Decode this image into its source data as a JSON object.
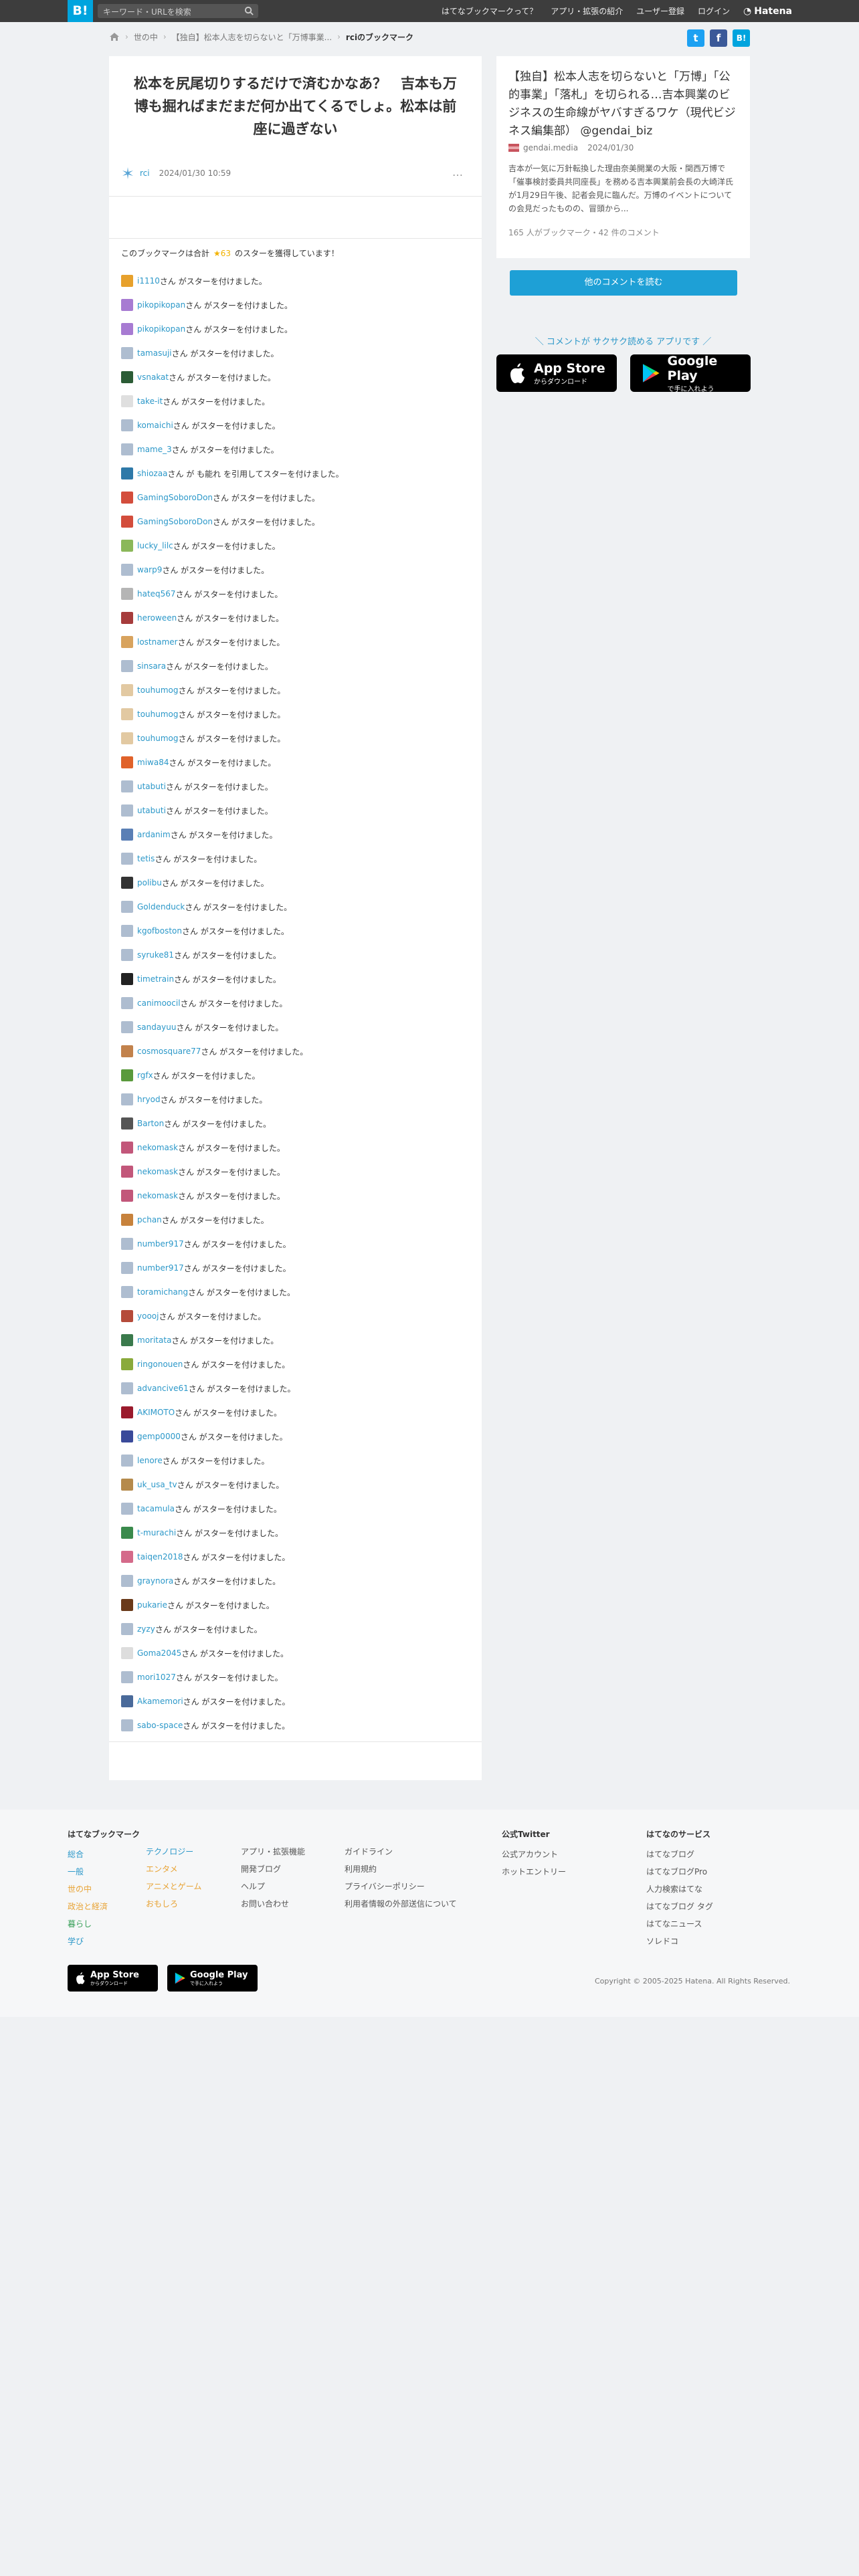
{
  "topbar": {
    "logo": "B!",
    "search_placeholder": "キーワード・URLを検索",
    "nav": [
      "はてなブックマークって？",
      "アプリ・拡張の紹介",
      "ユーザー登録",
      "ログイン"
    ],
    "hatena_label": "Hatena"
  },
  "breadcrumb": {
    "items": [
      "世の中",
      "【独自】松本人志を切らないと「万博事業..."
    ],
    "current": "rciのブックマーク"
  },
  "share": {
    "twitter": "t",
    "facebook": "f",
    "hatebu": "B!"
  },
  "entry": {
    "title": "松本を尻尾切りするだけで済むかなあ？　吉本も万博も掘ればまだまだ何か出てくるでしょ。松本は前座に過ぎない",
    "user": "rci",
    "date": "2024/01/30 10:59",
    "more": "…"
  },
  "summary": {
    "prefix": "このブックマークは合計",
    "star": "★63",
    "suffix": "のスターを獲得しています！"
  },
  "stars": [
    {
      "user": "i1110",
      "text": "さん がスターを付けました。",
      "color": "#e7a12c"
    },
    {
      "user": "pikopikopan",
      "text": "さん がスターを付けました。",
      "color": "#a77bd2"
    },
    {
      "user": "pikopikopan",
      "text": "さん がスターを付けました。",
      "color": "#a77bd2"
    },
    {
      "user": "tamasuji",
      "text": "さん がスターを付けました。",
      "color": "#aebdd0"
    },
    {
      "user": "vsnakat",
      "text": "さん がスターを付けました。",
      "color": "#2b5c35"
    },
    {
      "user": "take-it",
      "text": "さん がスターを付けました。",
      "color": "#dfdfdf"
    },
    {
      "user": "komaichi",
      "text": "さん がスターを付けました。",
      "color": "#aebdd0"
    },
    {
      "user": "mame_3",
      "text": "さん がスターを付けました。",
      "color": "#aebdd0"
    },
    {
      "user": "shiozaa",
      "text": "さん が も能れ を引用してスターを付けました。",
      "color": "#2e79a8"
    },
    {
      "user": "GamingSoboroDon",
      "text": "さん がスターを付けました。",
      "color": "#d34d3c"
    },
    {
      "user": "GamingSoboroDon",
      "text": "さん がスターを付けました。",
      "color": "#d34d3c"
    },
    {
      "user": "lucky_lilc",
      "text": "さん がスターを付けました。",
      "color": "#8bb85a"
    },
    {
      "user": "warp9",
      "text": "さん がスターを付けました。",
      "color": "#aebdd0"
    },
    {
      "user": "hateq567",
      "text": "さん がスターを付けました。",
      "color": "#b5b5b5"
    },
    {
      "user": "heroween",
      "text": "さん がスターを付けました。",
      "color": "#a63c3c"
    },
    {
      "user": "lostnamer",
      "text": "さん がスターを付けました。",
      "color": "#d8a35e"
    },
    {
      "user": "sinsara",
      "text": "さん がスターを付けました。",
      "color": "#aebdd0"
    },
    {
      "user": "touhumog",
      "text": "さん がスターを付けました。",
      "color": "#e2c9a2"
    },
    {
      "user": "touhumog",
      "text": "さん がスターを付けました。",
      "color": "#e2c9a2"
    },
    {
      "user": "touhumog",
      "text": "さん がスターを付けました。",
      "color": "#e2c9a2"
    },
    {
      "user": "miwa84",
      "text": "さん がスターを付けました。",
      "color": "#e0622a"
    },
    {
      "user": "utabuti",
      "text": "さん がスターを付けました。",
      "color": "#aebdd0"
    },
    {
      "user": "utabuti",
      "text": "さん がスターを付けました。",
      "color": "#aebdd0"
    },
    {
      "user": "ardanim",
      "text": "さん がスターを付けました。",
      "color": "#5a7fb5"
    },
    {
      "user": "tetis",
      "text": "さん がスターを付けました。",
      "color": "#aebdd0"
    },
    {
      "user": "polibu",
      "text": "さん がスターを付けました。",
      "color": "#333333"
    },
    {
      "user": "Goldenduck",
      "text": "さん がスターを付けました。",
      "color": "#aebdd0"
    },
    {
      "user": "kgofboston",
      "text": "さん がスターを付けました。",
      "color": "#aebdd0"
    },
    {
      "user": "syruke81",
      "text": "さん がスターを付けました。",
      "color": "#aebdd0"
    },
    {
      "user": "timetrain",
      "text": "さん がスターを付けました。",
      "color": "#222222"
    },
    {
      "user": "canimoocil",
      "text": "さん がスターを付けました。",
      "color": "#aebdd0"
    },
    {
      "user": "sandayuu",
      "text": "さん がスターを付けました。",
      "color": "#aebdd0"
    },
    {
      "user": "cosmosquare77",
      "text": "さん がスターを付けました。",
      "color": "#c2824c"
    },
    {
      "user": "rgfx",
      "text": "さん がスターを付けました。",
      "color": "#5a9a3c"
    },
    {
      "user": "hryod",
      "text": "さん がスターを付けました。",
      "color": "#aebdd0"
    },
    {
      "user": "Barton",
      "text": "さん がスターを付けました。",
      "color": "#555555"
    },
    {
      "user": "nekomask",
      "text": "さん がスターを付けました。",
      "color": "#c2577a"
    },
    {
      "user": "nekomask",
      "text": "さん がスターを付けました。",
      "color": "#c2577a"
    },
    {
      "user": "nekomask",
      "text": "さん がスターを付けました。",
      "color": "#c2577a"
    },
    {
      "user": "pchan",
      "text": "さん がスターを付けました。",
      "color": "#c7823c"
    },
    {
      "user": "number917",
      "text": "さん がスターを付けました。",
      "color": "#aebdd0"
    },
    {
      "user": "number917",
      "text": "さん がスターを付けました。",
      "color": "#aebdd0"
    },
    {
      "user": "toramichang",
      "text": "さん がスターを付けました。",
      "color": "#aebdd0"
    },
    {
      "user": "yoooj",
      "text": "さん がスターを付けました。",
      "color": "#b54b3a"
    },
    {
      "user": "moritata",
      "text": "さん がスターを付けました。",
      "color": "#3a7a4c"
    },
    {
      "user": "ringonouen",
      "text": "さん がスターを付けました。",
      "color": "#8aaa3c"
    },
    {
      "user": "advancive61",
      "text": "さん がスターを付けました。",
      "color": "#aebdd0"
    },
    {
      "user": "AKIMOTO",
      "text": "さん がスターを付けました。",
      "color": "#9a1a2c"
    },
    {
      "user": "gemp0000",
      "text": "さん がスターを付けました。",
      "color": "#3a4a9a"
    },
    {
      "user": "lenore",
      "text": "さん がスターを付けました。",
      "color": "#aebdd0"
    },
    {
      "user": "uk_usa_tv",
      "text": "さん がスターを付けました。",
      "color": "#b58a4c"
    },
    {
      "user": "tacamula",
      "text": "さん がスターを付けました。",
      "color": "#aebdd0"
    },
    {
      "user": "t-murachi",
      "text": "さん がスターを付けました。",
      "color": "#3a8a4c"
    },
    {
      "user": "taiqen2018",
      "text": "さん がスターを付けました。",
      "color": "#d46a8a"
    },
    {
      "user": "graynora",
      "text": "さん がスターを付けました。",
      "color": "#aebdd0"
    },
    {
      "user": "pukarie",
      "text": "さん がスターを付けました。",
      "color": "#6a3a1a"
    },
    {
      "user": "zyzy",
      "text": "さん がスターを付けました。",
      "color": "#aebdd0"
    },
    {
      "user": "Goma2045",
      "text": "さん がスターを付けました。",
      "color": "#dddddd"
    },
    {
      "user": "mori1027",
      "text": "さん がスターを付けました。",
      "color": "#aebdd0"
    },
    {
      "user": "Akamemori",
      "text": "さん がスターを付けました。",
      "color": "#4a6a9a"
    },
    {
      "user": "sabo-space",
      "text": "さん がスターを付けました。",
      "color": "#aebdd0"
    }
  ],
  "side": {
    "title": "【独自】松本人志を切らないと「万博」「公的事業」「落札」を切られる…吉本興業のビジネスの生命線がヤバすぎるワケ（現代ビジネス編集部） @gendai_biz",
    "source": "gendai.media",
    "date": "2024/01/30",
    "desc": "吉本が一気に万針転換した理由奈美開業の大阪・関西万博で「催事検討委員共同座長」を務める吉本興業前会長の大崎洋氏が1月29日午後、記者会見に臨んだ。万博のイベントについての会見だったものの、冒頭から...",
    "count": "165 人がブックマーク・42 件のコメント",
    "comment_button": "他のコメントを読む"
  },
  "promo": {
    "text": "＼ コメントが サクサク読める アプリです ／",
    "appstore_top": "App Store",
    "appstore_sub": "からダウンロード",
    "gplay_top": "Google Play",
    "gplay_sub": "で手に入れよう"
  },
  "footer": {
    "col1_title": "はてなブックマーク",
    "col1a": [
      "総合",
      "一般",
      "世の中",
      "政治と経済",
      "暮らし",
      "学び"
    ],
    "col1b": [
      "テクノロジー",
      "エンタメ",
      "アニメとゲーム",
      "おもしろ"
    ],
    "col2": [
      "アプリ・拡張機能",
      "開発ブログ",
      "ヘルプ",
      "お問い合わせ"
    ],
    "col3": [
      "ガイドライン",
      "利用規約",
      "プライバシーポリシー",
      "利用者情報の外部送信について"
    ],
    "col4_title": "公式Twitter",
    "col4": [
      "公式アカウント",
      "ホットエントリー"
    ],
    "col5_title": "はてなのサービス",
    "col5": [
      "はてなブログ",
      "はてなブログPro",
      "人力検索はてな",
      "はてなブログ タグ",
      "はてなニュース",
      "ソレドコ"
    ],
    "copyright": "Copyright © 2005-2025 Hatena. All Rights Reserved."
  },
  "colors": {
    "brand": "#00a4de",
    "link": "#2c98c9",
    "star": "#f2b200"
  }
}
